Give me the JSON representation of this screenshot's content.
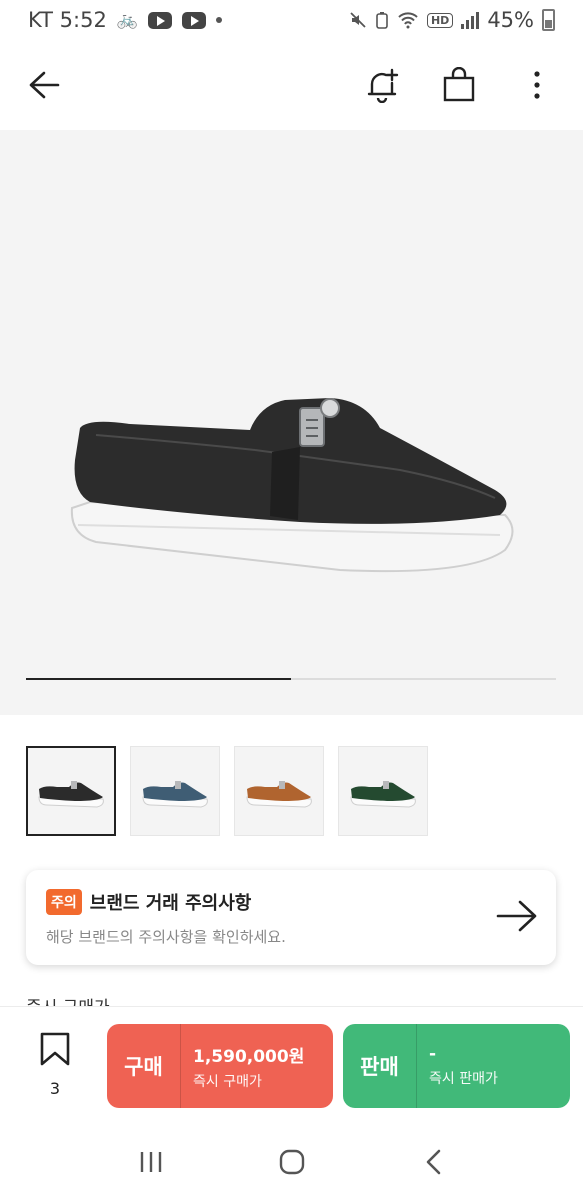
{
  "status_bar": {
    "carrier_time": "KT 5:52",
    "battery": "45%",
    "hd": "HD"
  },
  "nav": {
    "back": "back-arrow-icon",
    "alert": "bell-plus-icon",
    "bag": "shopping-bag-icon",
    "more": "more-vertical-icon"
  },
  "gallery": {
    "image_index": 1,
    "image_total": 2,
    "colors": [
      "#2b2b2b",
      "#3f5d74",
      "#b0642f",
      "#244a30"
    ]
  },
  "notice": {
    "badge": "주의",
    "title": "브랜드 거래 주의사항",
    "description": "해당 브랜드의 주의사항을 확인하세요."
  },
  "peek": {
    "text": "즉시 구매가"
  },
  "bottom": {
    "wish_count": "3",
    "buy": {
      "label": "구매",
      "price": "1,590,000원",
      "sub": "즉시 구매가",
      "color": "#ef6253"
    },
    "sell": {
      "label": "판매",
      "price": "-",
      "sub": "즉시 판매가",
      "color": "#41b979"
    }
  }
}
